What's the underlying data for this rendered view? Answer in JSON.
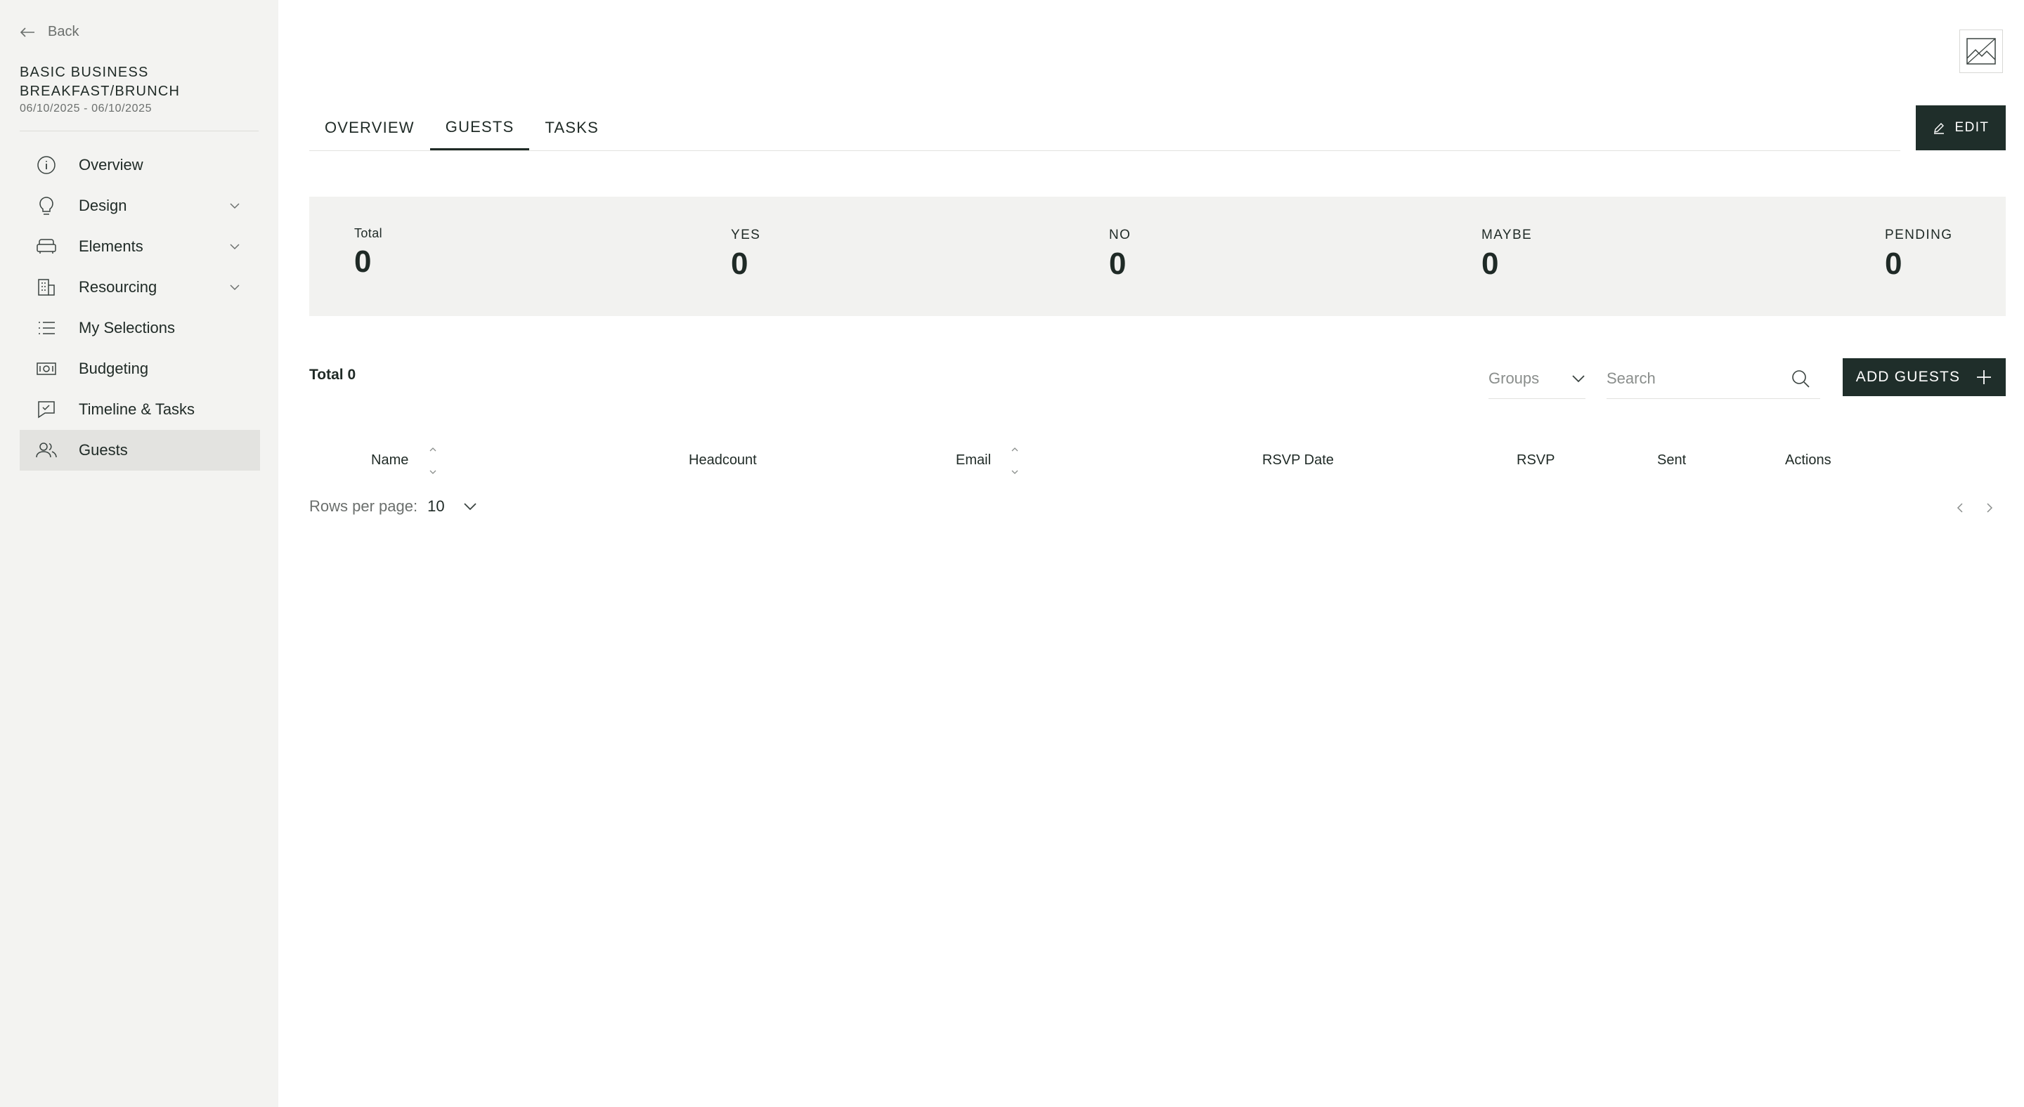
{
  "sidebar": {
    "back_label": "Back",
    "event_title": "BASIC BUSINESS BREAKFAST/BRUNCH",
    "event_dates": "06/10/2025 - 06/10/2025",
    "items": [
      {
        "label": "Overview",
        "icon": "info-icon",
        "expandable": false,
        "active": false
      },
      {
        "label": "Design",
        "icon": "lightbulb-icon",
        "expandable": true,
        "active": false
      },
      {
        "label": "Elements",
        "icon": "sofa-icon",
        "expandable": true,
        "active": false
      },
      {
        "label": "Resourcing",
        "icon": "building-icon",
        "expandable": true,
        "active": false
      },
      {
        "label": "My Selections",
        "icon": "list-icon",
        "expandable": false,
        "active": false
      },
      {
        "label": "Budgeting",
        "icon": "banknote-icon",
        "expandable": false,
        "active": false
      },
      {
        "label": "Timeline & Tasks",
        "icon": "checklist-icon",
        "expandable": false,
        "active": false
      },
      {
        "label": "Guests",
        "icon": "users-icon",
        "expandable": false,
        "active": true
      }
    ]
  },
  "tabs": [
    {
      "label": "OVERVIEW",
      "active": false
    },
    {
      "label": "GUESTS",
      "active": true
    },
    {
      "label": "TASKS",
      "active": false
    }
  ],
  "edit_label": "EDIT",
  "stats": [
    {
      "label": "Total",
      "value": "0"
    },
    {
      "label": "YES",
      "value": "0"
    },
    {
      "label": "NO",
      "value": "0"
    },
    {
      "label": "MAYBE",
      "value": "0"
    },
    {
      "label": "PENDING",
      "value": "0"
    }
  ],
  "guest_list": {
    "total_label": "Total 0",
    "groups_label": "Groups",
    "search_placeholder": "Search",
    "add_label": "ADD GUESTS",
    "columns": [
      "Name",
      "Headcount",
      "Email",
      "RSVP Date",
      "RSVP",
      "Sent",
      "Actions"
    ],
    "rows_per_page_label": "Rows per page:",
    "rows_per_page_value": "10"
  },
  "colors": {
    "accent": "#1f2e2a",
    "sidebar_bg": "#f3f3f1",
    "stats_bg": "#f2f2f0"
  }
}
